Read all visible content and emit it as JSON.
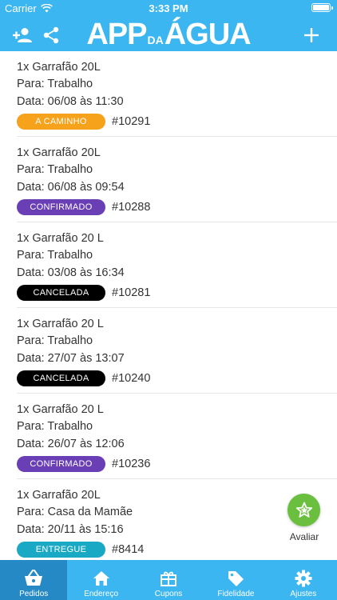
{
  "status_bar": {
    "carrier": "Carrier",
    "time": "3:33 PM"
  },
  "header": {
    "logo": {
      "part1": "APP",
      "part2": "DA",
      "part3": "ÁGUA"
    },
    "icons": [
      "add-user-icon",
      "share-icon",
      "plus-icon"
    ]
  },
  "orders": [
    {
      "item": "1x Garrafão 20L",
      "to": "Para: Trabalho",
      "date": "Data: 06/08 às 11:30",
      "status": "A CAMINHO",
      "status_color": "#f7a21b",
      "id": "#10291"
    },
    {
      "item": "1x Garrafão 20L",
      "to": "Para: Trabalho",
      "date": "Data: 06/08 às 09:54",
      "status": "CONFIRMADO",
      "status_color": "#6a3fb5",
      "id": "#10288"
    },
    {
      "item": "1x Garrafão 20 L",
      "to": "Para: Trabalho",
      "date": "Data: 03/08 às 16:34",
      "status": "CANCELADA",
      "status_color": "#000000",
      "id": "#10281"
    },
    {
      "item": "1x Garrafão 20 L",
      "to": "Para: Trabalho",
      "date": "Data: 27/07 às 13:07",
      "status": "CANCELADA",
      "status_color": "#000000",
      "id": "#10240"
    },
    {
      "item": "1x Garrafão 20 L",
      "to": "Para: Trabalho",
      "date": "Data: 26/07 às 12:06",
      "status": "CONFIRMADO",
      "status_color": "#6a3fb5",
      "id": "#10236"
    },
    {
      "item": "1x Garrafão 20L",
      "to": "Para: Casa da Mamãe",
      "date": "Data: 20/11 às 15:16",
      "status": "ENTREGUE",
      "status_color": "#1aa9c4",
      "id": "#8414"
    }
  ],
  "fab": {
    "label": "Avaliar",
    "icon": "star-icon",
    "color": "#6bbf3e"
  },
  "tabs": [
    {
      "label": "Pedidos",
      "icon": "basket-icon",
      "active": true
    },
    {
      "label": "Endereço",
      "icon": "home-icon",
      "active": false
    },
    {
      "label": "Cupons",
      "icon": "gift-icon",
      "active": false
    },
    {
      "label": "Fidelidade",
      "icon": "tag-icon",
      "active": false
    },
    {
      "label": "Ajustes",
      "icon": "gear-icon",
      "active": false
    }
  ],
  "colors": {
    "header": "#3cb6f1",
    "active_tab": "#2589c5"
  }
}
